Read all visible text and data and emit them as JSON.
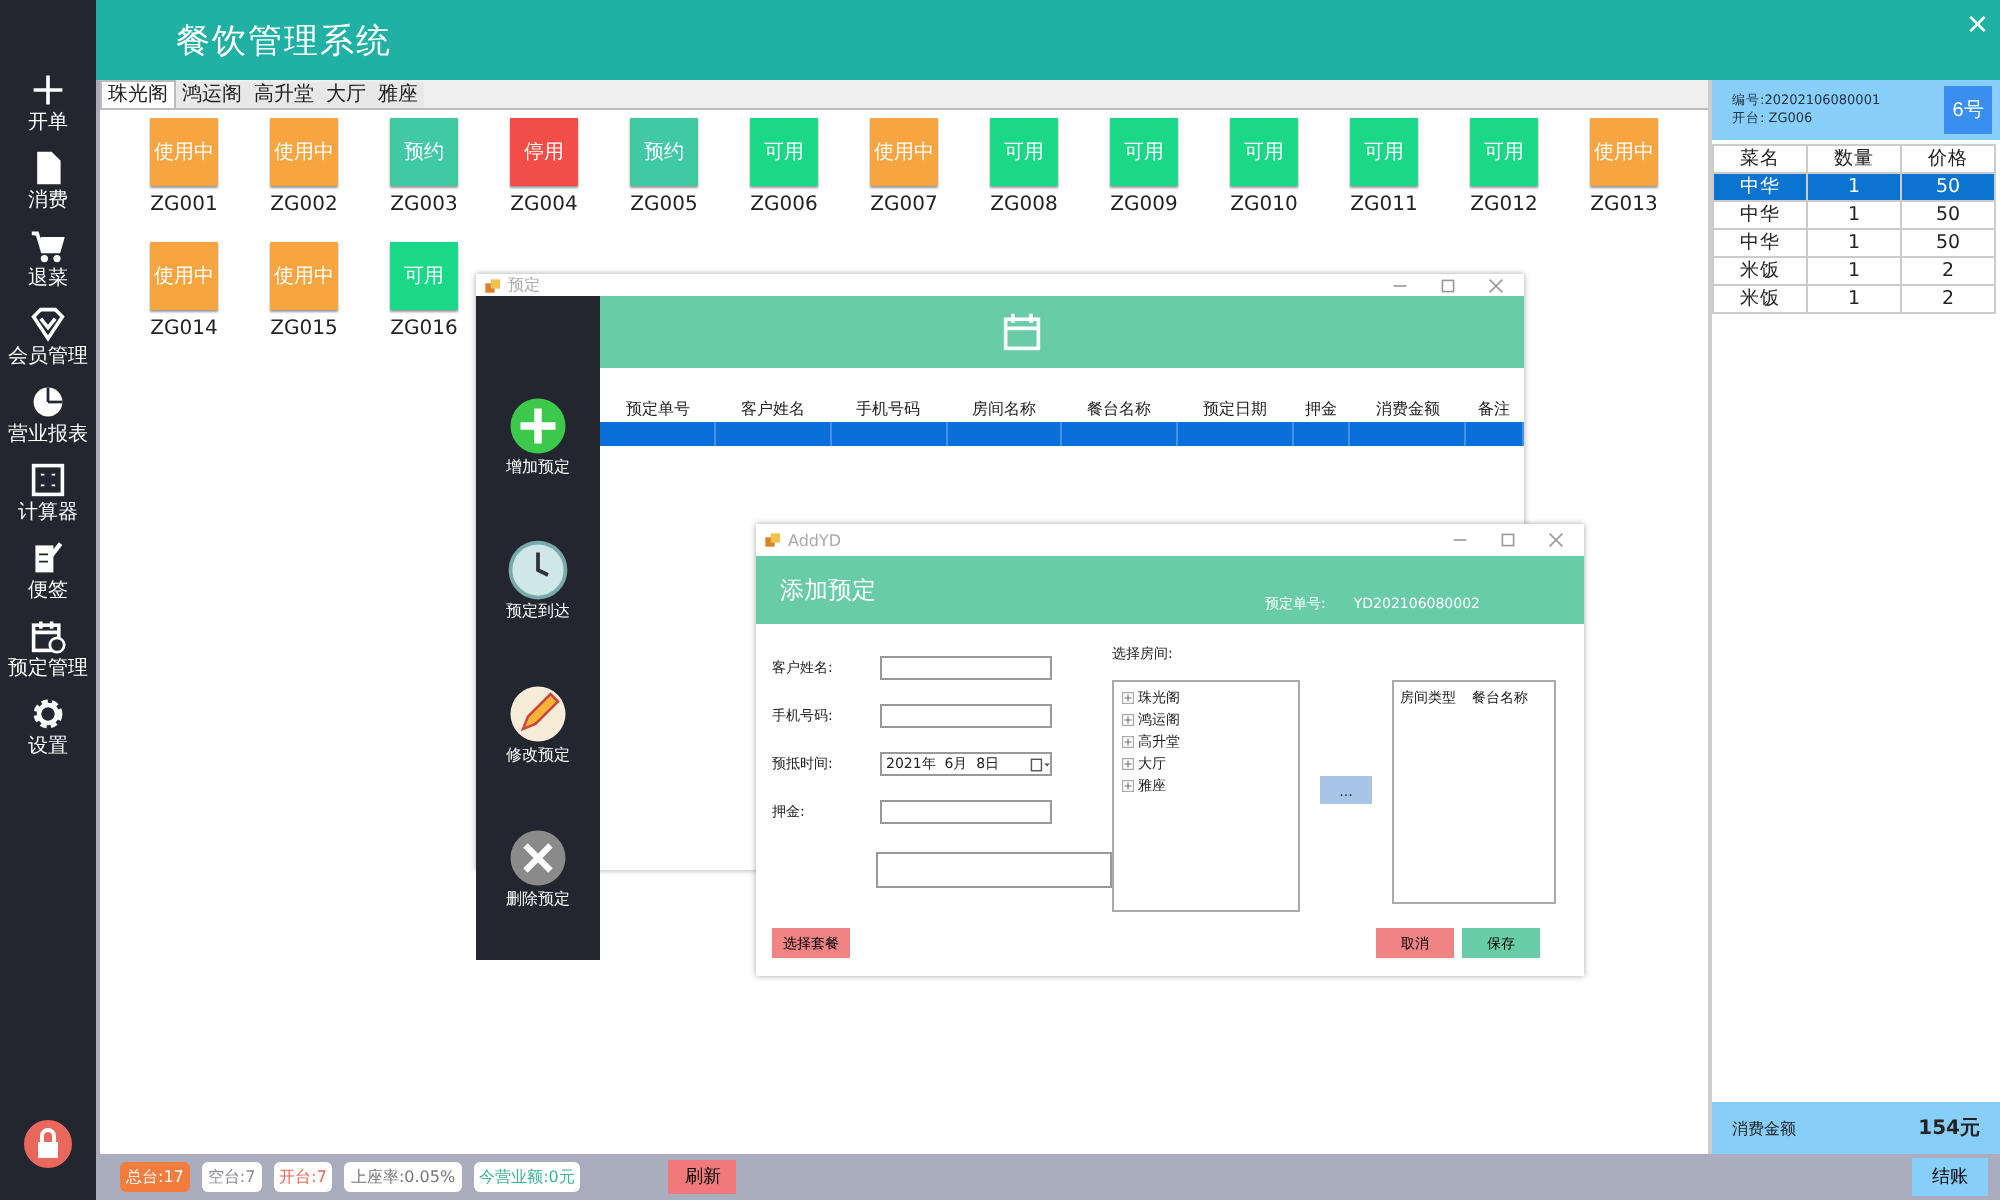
{
  "window": {
    "title": "餐饮管理系统",
    "close": "×"
  },
  "sidebar": {
    "items": [
      {
        "label": "开单"
      },
      {
        "label": "消费"
      },
      {
        "label": "退菜"
      },
      {
        "label": "会员管理"
      },
      {
        "label": "营业报表"
      },
      {
        "label": "计算器"
      },
      {
        "label": "便签"
      },
      {
        "label": "预定管理"
      },
      {
        "label": "设置"
      }
    ]
  },
  "tabs": [
    {
      "label": "珠光阁",
      "selected": true
    },
    {
      "label": "鸿运阁",
      "selected": false
    },
    {
      "label": "高升堂",
      "selected": false
    },
    {
      "label": "大厅",
      "selected": false
    },
    {
      "label": "雅座",
      "selected": false
    }
  ],
  "tables": [
    {
      "name": "ZG001",
      "status": "使用中",
      "kind": "in_use"
    },
    {
      "name": "ZG002",
      "status": "使用中",
      "kind": "in_use"
    },
    {
      "name": "ZG003",
      "status": "预约",
      "kind": "reserved"
    },
    {
      "name": "ZG004",
      "status": "停用",
      "kind": "disabled"
    },
    {
      "name": "ZG005",
      "status": "预约",
      "kind": "reserved"
    },
    {
      "name": "ZG006",
      "status": "可用",
      "kind": "free"
    },
    {
      "name": "ZG007",
      "status": "使用中",
      "kind": "in_use"
    },
    {
      "name": "ZG008",
      "status": "可用",
      "kind": "free"
    },
    {
      "name": "ZG009",
      "status": "可用",
      "kind": "free"
    },
    {
      "name": "ZG010",
      "status": "可用",
      "kind": "free"
    },
    {
      "name": "ZG011",
      "status": "可用",
      "kind": "free"
    },
    {
      "name": "ZG012",
      "status": "可用",
      "kind": "free"
    },
    {
      "name": "ZG013",
      "status": "使用中",
      "kind": "in_use"
    },
    {
      "name": "ZG014",
      "status": "使用中",
      "kind": "in_use"
    },
    {
      "name": "ZG015",
      "status": "使用中",
      "kind": "in_use"
    },
    {
      "name": "ZG016",
      "status": "可用",
      "kind": "free"
    }
  ],
  "order_panel": {
    "number": "编号:20202106080001",
    "opened": "开台: ZG006",
    "seat_button": "6号",
    "columns": [
      "菜名",
      "数量",
      "价格"
    ],
    "rows": [
      {
        "cells": [
          "中华",
          "1",
          "50"
        ],
        "selected": true
      },
      {
        "cells": [
          "中华",
          "1",
          "50"
        ],
        "selected": false
      },
      {
        "cells": [
          "中华",
          "1",
          "50"
        ],
        "selected": false
      },
      {
        "cells": [
          "米饭",
          "1",
          "2"
        ],
        "selected": false
      },
      {
        "cells": [
          "米饭",
          "1",
          "2"
        ],
        "selected": false
      }
    ],
    "total_label": "消费金额",
    "total": "154元",
    "checkout": "结账"
  },
  "status_bar": {
    "stats": [
      {
        "text": "总台:17",
        "kind": "total"
      },
      {
        "text": "空台:7",
        "kind": "free"
      },
      {
        "text": "开台:7",
        "kind": "open"
      },
      {
        "text": "上座率:0.05%",
        "kind": "rate"
      },
      {
        "text": "今营业额:0元",
        "kind": "revenue"
      }
    ],
    "refresh": "刷新"
  },
  "reservation_window": {
    "title": "预定",
    "actions": [
      {
        "label": "增加预定"
      },
      {
        "label": "预定到达"
      },
      {
        "label": "修改预定"
      },
      {
        "label": "删除预定"
      }
    ],
    "columns": [
      "预定单号",
      "客户姓名",
      "手机号码",
      "房间名称",
      "餐台名称",
      "预定日期",
      "押金",
      "消费金额",
      "备注"
    ],
    "rows": [
      {
        "selected": true
      }
    ]
  },
  "add_window": {
    "title": "AddYD",
    "heading": "添加预定",
    "number_label": "预定单号:",
    "number": "YD202106080002",
    "fields": [
      {
        "label": "客户姓名:",
        "kind": "text"
      },
      {
        "label": "手机号码:",
        "kind": "text"
      },
      {
        "label": "预抵时间:",
        "kind": "date",
        "value": "2021年  6月  8日"
      },
      {
        "label": "押金:",
        "kind": "text"
      }
    ],
    "room_label": "选择房间:",
    "rooms": [
      {
        "label": "珠光阁",
        "expanded": false
      },
      {
        "label": "鸿运阁",
        "expanded": false
      },
      {
        "label": "高升堂",
        "expanded": false
      },
      {
        "label": "大厅",
        "expanded": false
      },
      {
        "label": "雅座",
        "expanded": false
      }
    ],
    "pick_button": "...",
    "list_columns": [
      "房间类型",
      "餐台名称"
    ],
    "buttons": [
      {
        "label": "选择套餐",
        "kind": "danger"
      },
      {
        "label": "取消",
        "kind": "danger"
      },
      {
        "label": "保存",
        "kind": "ok"
      }
    ]
  }
}
